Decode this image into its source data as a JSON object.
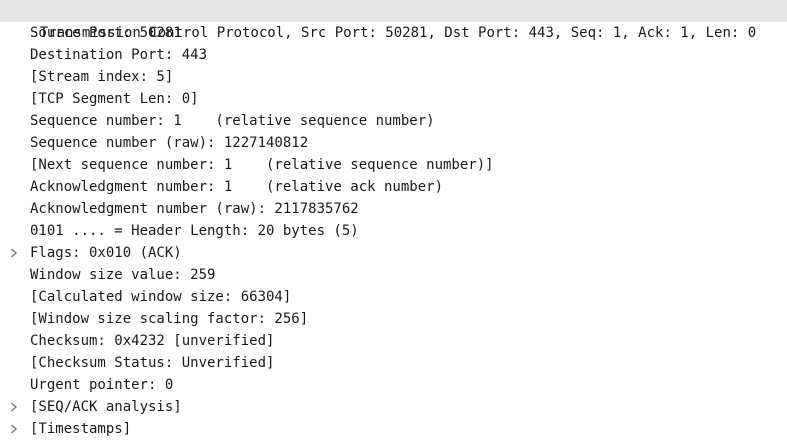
{
  "header": {
    "label": "Transmission Control Protocol, Src Port: 50281, Dst Port: 443, Seq: 1, Ack: 1, Len: 0",
    "background": "#e6e6e6"
  },
  "fields": [
    {
      "name": "field-source-port",
      "label": "Source Port: 50281",
      "expandable": false
    },
    {
      "name": "field-destination-port",
      "label": "Destination Port: 443",
      "expandable": false
    },
    {
      "name": "field-stream-index",
      "label": "[Stream index: 5]",
      "expandable": false
    },
    {
      "name": "field-tcp-segment-len",
      "label": "[TCP Segment Len: 0]",
      "expandable": false
    },
    {
      "name": "field-sequence-number",
      "label": "Sequence number: 1    (relative sequence number)",
      "expandable": false
    },
    {
      "name": "field-sequence-number-raw",
      "label": "Sequence number (raw): 1227140812",
      "expandable": false
    },
    {
      "name": "field-next-sequence-number",
      "label": "[Next sequence number: 1    (relative sequence number)]",
      "expandable": false
    },
    {
      "name": "field-ack-number",
      "label": "Acknowledgment number: 1    (relative ack number)",
      "expandable": false
    },
    {
      "name": "field-ack-number-raw",
      "label": "Acknowledgment number (raw): 2117835762",
      "expandable": false
    },
    {
      "name": "field-header-length",
      "label": "0101 .... = Header Length: 20 bytes (5)",
      "expandable": false
    },
    {
      "name": "field-flags",
      "label": "Flags: 0x010 (ACK)",
      "expandable": true
    },
    {
      "name": "field-window-size-value",
      "label": "Window size value: 259",
      "expandable": false
    },
    {
      "name": "field-calculated-window-size",
      "label": "[Calculated window size: 66304]",
      "expandable": false
    },
    {
      "name": "field-window-scaling-factor",
      "label": "[Window size scaling factor: 256]",
      "expandable": false
    },
    {
      "name": "field-checksum",
      "label": "Checksum: 0x4232 [unverified]",
      "expandable": false
    },
    {
      "name": "field-checksum-status",
      "label": "[Checksum Status: Unverified]",
      "expandable": false
    },
    {
      "name": "field-urgent-pointer",
      "label": "Urgent pointer: 0",
      "expandable": false
    },
    {
      "name": "field-seq-ack-analysis",
      "label": "[SEQ/ACK analysis]",
      "expandable": true
    },
    {
      "name": "field-timestamps",
      "label": "[Timestamps]",
      "expandable": true
    }
  ],
  "icons": {
    "expander": "chevron-right-icon"
  },
  "colors": {
    "text": "#1a1a1a",
    "expander": "#7a7a7a",
    "background": "#ffffff"
  }
}
